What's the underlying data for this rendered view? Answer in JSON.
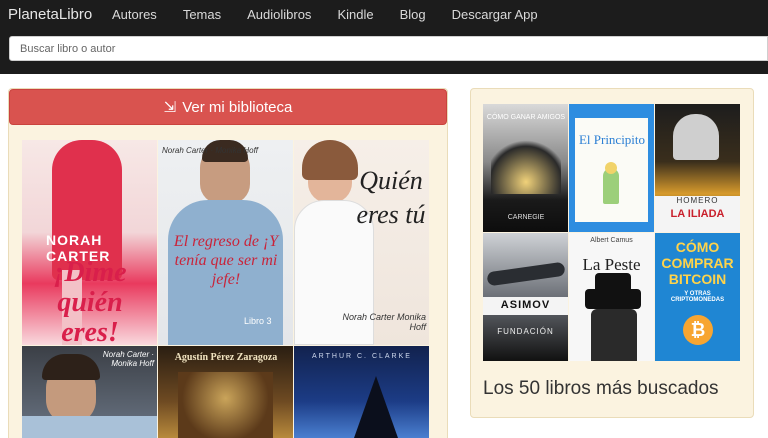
{
  "header": {
    "brand": "PlanetaLibro",
    "nav": [
      "Autores",
      "Temas",
      "Audiolibros",
      "Kindle",
      "Blog",
      "Descargar App"
    ],
    "search_placeholder": "Buscar libro o autor"
  },
  "library_button": {
    "label": "Ver mi biblioteca",
    "icon": "sign-in-icon"
  },
  "left_covers": [
    {
      "author": "NORAH CARTER",
      "title": "¡Dime quién eres!"
    },
    {
      "title": "El regreso de ¡Y tenía que ser mi jefe!",
      "authors": "Norah Carter · Monika Hoff",
      "badge": "Libro 3"
    },
    {
      "title": "Quién eres tú",
      "authors": "Norah Carter Monika Hoff"
    },
    {
      "authors": "Norah Carter · Monika Hoff"
    },
    {
      "author": "Agustín Pérez Zaragoza"
    },
    {
      "author": "ARTHUR C. CLARKE"
    }
  ],
  "right_covers": [
    {
      "title": "CÓMO GANAR AMIGOS",
      "author": "CARNEGIE"
    },
    {
      "title": "El Principito"
    },
    {
      "author": "HOMERO",
      "title": "LA ILIADA"
    },
    {
      "author": "ASIMOV",
      "title": "FUNDACIÓN"
    },
    {
      "author": "Albert Camus",
      "title": "La Peste"
    },
    {
      "title": "CÓMO COMPRAR BITCOIN",
      "subtitle": "Y OTRAS CRIPTOMONEDAS"
    }
  ],
  "top_books_label": "Los 50 libros más buscados",
  "colors": {
    "header_bg": "#1c1c1c",
    "button_red": "#d9534f",
    "panel_bg": "#fbf3e0"
  }
}
